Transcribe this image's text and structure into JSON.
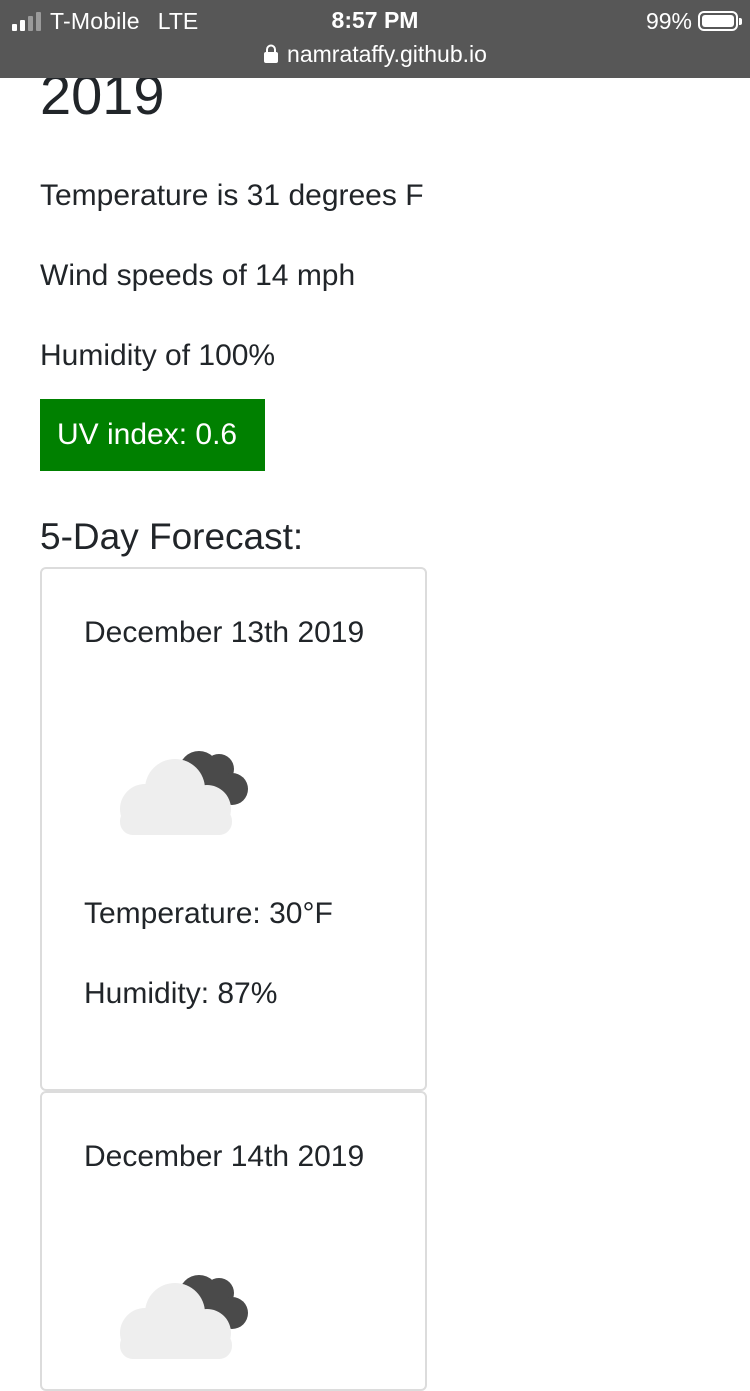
{
  "status_bar": {
    "carrier": "T-Mobile",
    "network": "LTE",
    "time": "8:57 PM",
    "battery_percent": "99%",
    "url": "namrataffy.github.io"
  },
  "current": {
    "date_heading_visible": "2019",
    "temperature": "Temperature is 31 degrees F",
    "wind": "Wind speeds of 14 mph",
    "humidity": "Humidity of 100%",
    "uv": "UV index: 0.6",
    "uv_color": "#008000"
  },
  "forecast": {
    "heading": "5-Day Forecast:",
    "days": [
      {
        "date": "December 13th 2019",
        "icon": "cloudy-icon",
        "temperature": "Temperature: 30°F",
        "humidity": "Humidity: 87%"
      },
      {
        "date": "December 14th 2019",
        "icon": "cloudy-icon"
      }
    ]
  }
}
